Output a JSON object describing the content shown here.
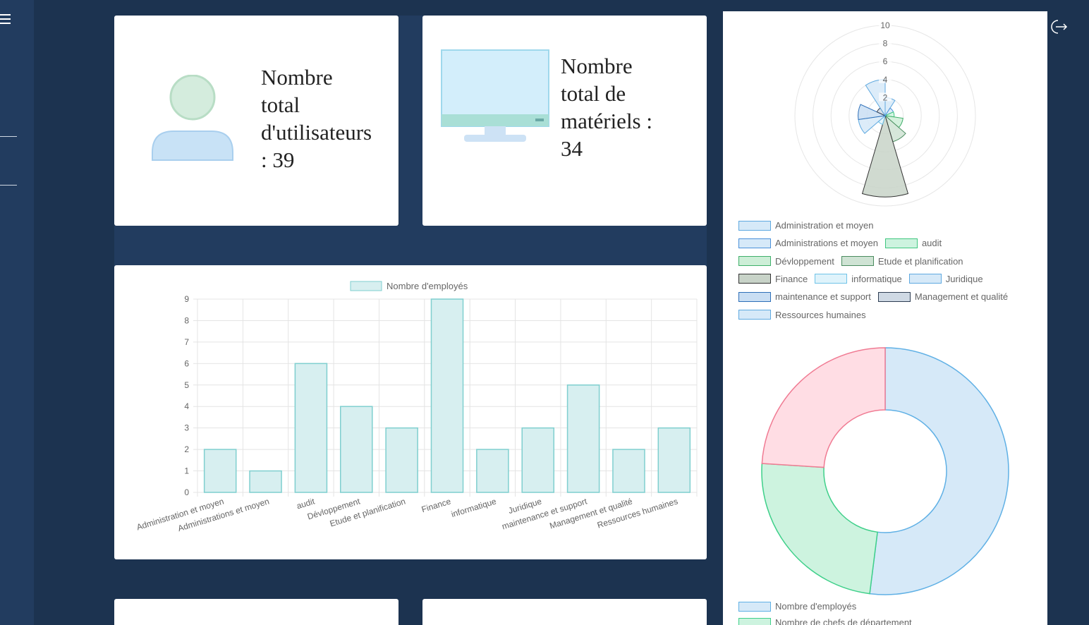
{
  "stats": {
    "users_text_lines": [
      "Nombre",
      "total",
      "d'utilisateurs",
      ": 39"
    ],
    "materials_text_lines": [
      "Nombre",
      "total de",
      "matériels :",
      "34"
    ]
  },
  "icons": {
    "menu": "hamburger-menu-icon",
    "logout": "logout-icon",
    "user": "user-icon",
    "monitor": "monitor-icon"
  },
  "colors": {
    "page_bg": "#1c3350",
    "sidebar_bg": "#223c5f",
    "card_bg": "#ffffff",
    "bar_fill": "#d7eff0",
    "bar_stroke": "#7fcfcf"
  },
  "chart_data": [
    {
      "type": "bar",
      "legend": "Nombre d'employés",
      "categories": [
        "Administration et moyen",
        "Administrations et moyen",
        "audit",
        "Dévloppement",
        "Etude et planification",
        "Finance",
        "informatique",
        "Juridique",
        "maintenance et support",
        "Management et qualité",
        "Ressources humaines"
      ],
      "values": [
        2,
        1,
        6,
        4,
        3,
        9,
        2,
        3,
        5,
        2,
        3
      ],
      "y_ticks": [
        "0",
        "1",
        "2",
        "3",
        "4",
        "5",
        "6",
        "7",
        "8",
        "9"
      ],
      "ylim": [
        0,
        9
      ],
      "grid": true,
      "legend_position": "top"
    },
    {
      "type": "polarArea",
      "labels": [
        "Administration et moyen",
        "Administrations et moyen",
        "audit",
        "Dévloppement",
        "Etude et planification",
        "Finance",
        "informatique",
        "Juridique",
        "maintenance et support",
        "Management et qualité",
        "Ressources humaines"
      ],
      "values": [
        2,
        1,
        1,
        2,
        3,
        9,
        1,
        3,
        3,
        1,
        4
      ],
      "r_ticks": [
        "2",
        "4",
        "6",
        "8",
        "10"
      ],
      "rlim": [
        0,
        10
      ],
      "legend_position": "bottom",
      "fills": [
        "#d6e9f8",
        "#d6e9f8",
        "#cdf3df",
        "#cdeed7",
        "#cfe3d4",
        "#c8d3c8",
        "#dff3fb",
        "#d6e9f8",
        "#c9def3",
        "#cfd9e4",
        "#d6e9f8"
      ],
      "strokes": [
        "#5fa9e0",
        "#4a90d9",
        "#3fc67f",
        "#3fb06a",
        "#4a8c5f",
        "#333",
        "#6fc3e8",
        "#5fa9e0",
        "#2e6fb8",
        "#2e3d52",
        "#5fa9e0"
      ]
    },
    {
      "type": "doughnut",
      "labels": [
        "Nombre d'employés",
        "Nombre de chefs de département",
        ""
      ],
      "values": [
        52,
        24,
        24
      ],
      "colors_fill": [
        "#d6e9f8",
        "#cdf3df",
        "#ffdde4"
      ],
      "colors_stroke": [
        "#5fb0e5",
        "#3fd08a",
        "#f07b93"
      ],
      "legend_position": "bottom"
    }
  ]
}
